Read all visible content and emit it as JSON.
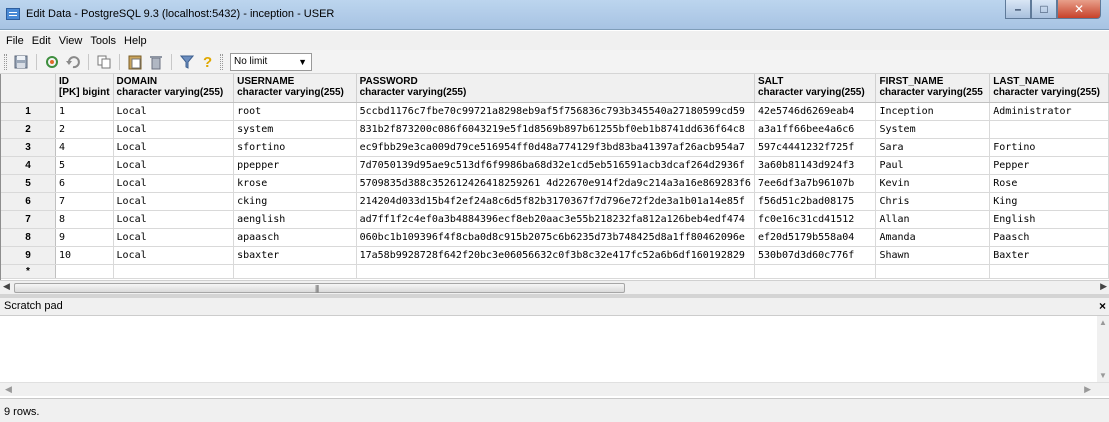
{
  "window": {
    "title": "Edit Data - PostgreSQL 9.3 (localhost:5432) - inception - USER",
    "minimize": "–",
    "maximize": "□",
    "close": "✕"
  },
  "menu": [
    {
      "label": "File"
    },
    {
      "label": "Edit"
    },
    {
      "label": "View"
    },
    {
      "label": "Tools"
    },
    {
      "label": "Help"
    }
  ],
  "toolbar": {
    "limit_select": "No limit"
  },
  "grid": {
    "columns": [
      {
        "name": "ID",
        "type": "[PK] bigint"
      },
      {
        "name": "DOMAIN",
        "type": "character varying(255)"
      },
      {
        "name": "USERNAME",
        "type": "character varying(255)"
      },
      {
        "name": "PASSWORD",
        "type": "character varying(255)"
      },
      {
        "name": "SALT",
        "type": "character varying(255)"
      },
      {
        "name": "FIRST_NAME",
        "type": "character varying(255"
      },
      {
        "name": "LAST_NAME",
        "type": "character varying(255)"
      }
    ],
    "rows": [
      {
        "n": "1",
        "cells": [
          "1",
          "Local",
          "root",
          "5ccbd1176c7fbe70c99721a8298eb9af5f756836c793b345540a27180599cd59",
          "42e5746d6269eab4",
          "Inception",
          "Administrator"
        ]
      },
      {
        "n": "2",
        "cells": [
          "2",
          "Local",
          "system",
          "831b2f873200c086f6043219e5f1d8569b897b61255bf0eb1b8741dd636f64c8",
          "a3a1ff66bee4a6c6",
          "System",
          ""
        ]
      },
      {
        "n": "3",
        "cells": [
          "4",
          "Local",
          "sfortino",
          "ec9fbb29e3ca009d79ce516954ff0d48a774129f3bd83ba41397af26acb954a7",
          "597c4441232f725f",
          "Sara",
          "Fortino"
        ]
      },
      {
        "n": "4",
        "cells": [
          "5",
          "Local",
          "ppepper",
          "7d7050139d95ae9c513df6f9986ba68d32e1cd5eb516591acb3dcaf264d2936f",
          "3a60b81143d924f3",
          "Paul",
          "Pepper"
        ]
      },
      {
        "n": "5",
        "cells": [
          "6",
          "Local",
          "krose",
          "5709835d388c352612426418259261 4d22670e914f2da9c214a3a16e869283f6",
          "7ee6df3a7b96107b",
          "Kevin",
          "Rose"
        ]
      },
      {
        "n": "6",
        "cells": [
          "7",
          "Local",
          "cking",
          "214204d033d15b4f2ef24a8c6d5f82b3170367f7d796e72f2de3a1b01a14e85f",
          "f56d51c2bad08175",
          "Chris",
          "King"
        ]
      },
      {
        "n": "7",
        "cells": [
          "8",
          "Local",
          "aenglish",
          "ad7ff1f2c4ef0a3b4884396ecf8eb20aac3e55b218232fa812a126beb4edf474",
          "fc0e16c31cd41512",
          "Allan",
          "English"
        ]
      },
      {
        "n": "8",
        "cells": [
          "9",
          "Local",
          "apaasch",
          "060bc1b109396f4f8cba0d8c915b2075c6b6235d73b748425d8a1ff80462096e",
          "ef20d5179b558a04",
          "Amanda",
          "Paasch"
        ]
      },
      {
        "n": "9",
        "cells": [
          "10",
          "Local",
          "sbaxter",
          "17a58b9928728f642f20bc3e06056632c0f3b8c32e417fc52a6b6df160192829",
          "530b07d3d60c776f",
          "Shawn",
          "Baxter"
        ]
      }
    ],
    "new_row_marker": "*"
  },
  "scratch_pad": {
    "title": "Scratch pad",
    "close": "×"
  },
  "status": {
    "text": "9 rows."
  },
  "icons": [
    "save-icon",
    "refresh-icon",
    "undo-icon",
    "copy-icon",
    "paste-icon",
    "delete-icon",
    "filter-icon",
    "help-icon"
  ]
}
